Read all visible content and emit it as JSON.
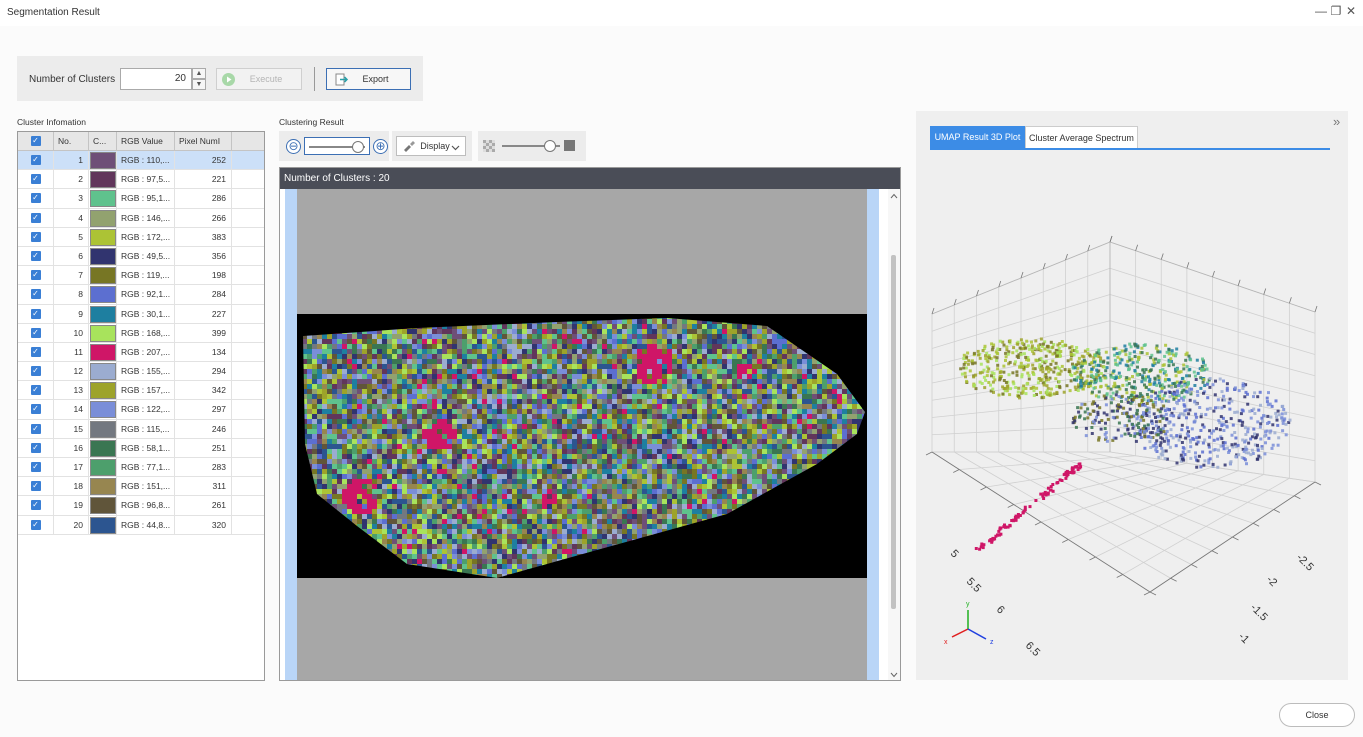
{
  "window": {
    "title": "Segmentation Result",
    "minimize_glyph": "—",
    "restore_glyph": "❐",
    "close_glyph": "✕"
  },
  "controls": {
    "clusters_label": "Number of Clusters",
    "clusters_value": "20",
    "spin_up": "▲",
    "spin_down": "▼",
    "execute_label": "Execute",
    "export_label": "Export"
  },
  "cluster_info": {
    "title": "Cluster Infomation",
    "columns": [
      "No.",
      "C...",
      "RGB Value",
      "Pixel NumI"
    ],
    "rows": [
      {
        "no": "1",
        "color": "#6e4f77",
        "rgb": "RGB : 110,...",
        "pixels": "252"
      },
      {
        "no": "2",
        "color": "#61365b",
        "rgb": "RGB : 97,5...",
        "pixels": "221"
      },
      {
        "no": "3",
        "color": "#5fc28d",
        "rgb": "RGB : 95,1...",
        "pixels": "286"
      },
      {
        "no": "4",
        "color": "#92a26f",
        "rgb": "RGB : 146,...",
        "pixels": "266"
      },
      {
        "no": "5",
        "color": "#acc335",
        "rgb": "RGB : 172,...",
        "pixels": "383"
      },
      {
        "no": "6",
        "color": "#31346f",
        "rgb": "RGB : 49,5...",
        "pixels": "356"
      },
      {
        "no": "7",
        "color": "#777624",
        "rgb": "RGB : 119,...",
        "pixels": "198"
      },
      {
        "no": "8",
        "color": "#5c6fd0",
        "rgb": "RGB : 92,1...",
        "pixels": "284"
      },
      {
        "no": "9",
        "color": "#1e7fa0",
        "rgb": "RGB : 30,1...",
        "pixels": "227"
      },
      {
        "no": "10",
        "color": "#a8e35c",
        "rgb": "RGB : 168,...",
        "pixels": "399"
      },
      {
        "no": "11",
        "color": "#cf1667",
        "rgb": "RGB : 207,...",
        "pixels": "134"
      },
      {
        "no": "12",
        "color": "#9bacd0",
        "rgb": "RGB : 155,...",
        "pixels": "294"
      },
      {
        "no": "13",
        "color": "#9da32a",
        "rgb": "RGB : 157,...",
        "pixels": "342"
      },
      {
        "no": "14",
        "color": "#7a8ed8",
        "rgb": "RGB : 122,...",
        "pixels": "297"
      },
      {
        "no": "15",
        "color": "#737880",
        "rgb": "RGB : 115,...",
        "pixels": "246"
      },
      {
        "no": "16",
        "color": "#3a7652",
        "rgb": "RGB : 58,1...",
        "pixels": "251"
      },
      {
        "no": "17",
        "color": "#4d9f6c",
        "rgb": "RGB : 77,1...",
        "pixels": "283"
      },
      {
        "no": "18",
        "color": "#978650",
        "rgb": "RGB : 151,...",
        "pixels": "311"
      },
      {
        "no": "19",
        "color": "#60553a",
        "rgb": "RGB : 96,8...",
        "pixels": "261"
      },
      {
        "no": "20",
        "color": "#2c5590",
        "rgb": "RGB : 44,8...",
        "pixels": "320"
      }
    ]
  },
  "clustering": {
    "title": "Clustering Result",
    "zoom_out_glyph": "⊖",
    "zoom_in_glyph": "⊕",
    "zoom_slider_level": 0.88,
    "display_label": "Display",
    "opacity_slider_level": 0.82,
    "header": "Number of Clusters : 20"
  },
  "right_panel": {
    "tabs": [
      "UMAP Result 3D Plot",
      "Cluster Average Spectrum"
    ],
    "active_tab": 0,
    "collapse_glyph": "»"
  },
  "plot3d": {
    "x_ticks": [
      "5",
      "5.5",
      "6",
      "6.5"
    ],
    "y_ticks": [
      "-2.5",
      "-2",
      "-1.5",
      "-1"
    ],
    "gizmo_labels": [
      "x",
      "y",
      "z"
    ],
    "gizmo_colors": [
      "#e02020",
      "#20b020",
      "#2040e0"
    ],
    "cluster_colors": [
      "#a8e35c",
      "#acc335",
      "#9da32a",
      "#5fc28d",
      "#1e7fa0",
      "#5c6fd0",
      "#9bacd0",
      "#7a8ed8",
      "#3a7652",
      "#777624",
      "#cf1667",
      "#31346f"
    ]
  },
  "footer": {
    "close_label": "Close"
  },
  "colors": {
    "accent": "#3c8ce6",
    "checkbox": "#3a7fd5",
    "selected_row": "#cce0f8"
  }
}
